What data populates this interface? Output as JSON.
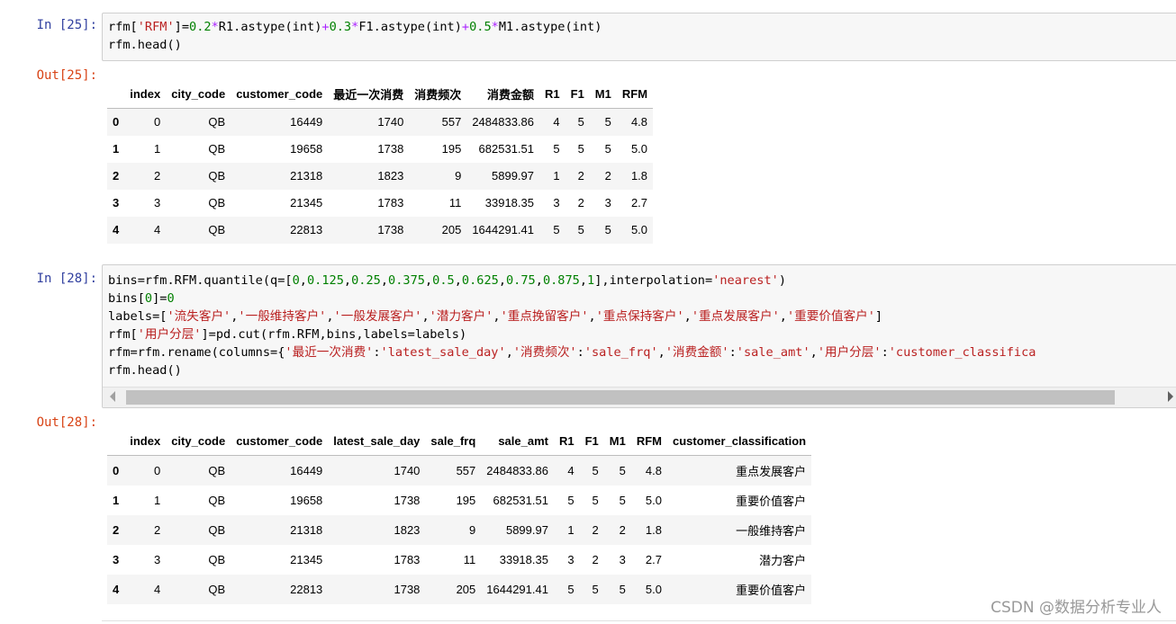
{
  "cells": [
    {
      "in_prompt": "In  [25]:",
      "out_prompt": "Out[25]:",
      "code_lines": [
        [
          [
            "t",
            "rfm["
          ],
          [
            "s",
            "'RFM'"
          ],
          [
            "t",
            "]="
          ],
          [
            "n",
            "0.2"
          ],
          [
            "o",
            "*"
          ],
          [
            "t",
            "R1.astype(int)"
          ],
          [
            "o",
            "+"
          ],
          [
            "n",
            "0.3"
          ],
          [
            "o",
            "*"
          ],
          [
            "t",
            "F1.astype(int)"
          ],
          [
            "o",
            "+"
          ],
          [
            "n",
            "0.5"
          ],
          [
            "o",
            "*"
          ],
          [
            "t",
            "M1.astype(int)"
          ]
        ],
        [
          [
            "t",
            "rfm.head()"
          ]
        ]
      ],
      "table": {
        "columns": [
          "",
          "index",
          "city_code",
          "customer_code",
          "最近一次消费",
          "消费频次",
          "消费金额",
          "R1",
          "F1",
          "M1",
          "RFM"
        ],
        "rows": [
          [
            "0",
            "0",
            "QB",
            "16449",
            "1740",
            "557",
            "2484833.86",
            "4",
            "5",
            "5",
            "4.8"
          ],
          [
            "1",
            "1",
            "QB",
            "19658",
            "1738",
            "195",
            "682531.51",
            "5",
            "5",
            "5",
            "5.0"
          ],
          [
            "2",
            "2",
            "QB",
            "21318",
            "1823",
            "9",
            "5899.97",
            "1",
            "2",
            "2",
            "1.8"
          ],
          [
            "3",
            "3",
            "QB",
            "21345",
            "1783",
            "11",
            "33918.35",
            "3",
            "2",
            "3",
            "2.7"
          ],
          [
            "4",
            "4",
            "QB",
            "22813",
            "1738",
            "205",
            "1644291.41",
            "5",
            "5",
            "5",
            "5.0"
          ]
        ]
      }
    },
    {
      "in_prompt": "In  [28]:",
      "out_prompt": "Out[28]:",
      "code_lines": [
        [
          [
            "t",
            "bins=rfm.RFM.quantile(q=["
          ],
          [
            "n",
            "0"
          ],
          [
            "t",
            ","
          ],
          [
            "n",
            "0.125"
          ],
          [
            "t",
            ","
          ],
          [
            "n",
            "0.25"
          ],
          [
            "t",
            ","
          ],
          [
            "n",
            "0.375"
          ],
          [
            "t",
            ","
          ],
          [
            "n",
            "0.5"
          ],
          [
            "t",
            ","
          ],
          [
            "n",
            "0.625"
          ],
          [
            "t",
            ","
          ],
          [
            "n",
            "0.75"
          ],
          [
            "t",
            ","
          ],
          [
            "n",
            "0.875"
          ],
          [
            "t",
            ","
          ],
          [
            "n",
            "1"
          ],
          [
            "t",
            "],interpolation="
          ],
          [
            "s",
            "'nearest'"
          ],
          [
            "t",
            ")"
          ]
        ],
        [
          [
            "t",
            "bins["
          ],
          [
            "n",
            "0"
          ],
          [
            "t",
            "]="
          ],
          [
            "n",
            "0"
          ]
        ],
        [
          [
            "t",
            "labels=["
          ],
          [
            "s",
            "'流失客户'"
          ],
          [
            "t",
            ","
          ],
          [
            "s",
            "'一般维持客户'"
          ],
          [
            "t",
            ","
          ],
          [
            "s",
            "'一般发展客户'"
          ],
          [
            "t",
            ","
          ],
          [
            "s",
            "'潜力客户'"
          ],
          [
            "t",
            ","
          ],
          [
            "s",
            "'重点挽留客户'"
          ],
          [
            "t",
            ","
          ],
          [
            "s",
            "'重点保持客户'"
          ],
          [
            "t",
            ","
          ],
          [
            "s",
            "'重点发展客户'"
          ],
          [
            "t",
            ","
          ],
          [
            "s",
            "'重要价值客户'"
          ],
          [
            "t",
            "]"
          ]
        ],
        [
          [
            "t",
            "rfm["
          ],
          [
            "s",
            "'用户分层'"
          ],
          [
            "t",
            "]=pd.cut(rfm.RFM,bins,labels=labels)"
          ]
        ],
        [
          [
            "t",
            "rfm=rfm.rename(columns={"
          ],
          [
            "s",
            "'最近一次消费'"
          ],
          [
            "t",
            ":"
          ],
          [
            "s",
            "'latest_sale_day'"
          ],
          [
            "t",
            ","
          ],
          [
            "s",
            "'消费频次'"
          ],
          [
            "t",
            ":"
          ],
          [
            "s",
            "'sale_frq'"
          ],
          [
            "t",
            ","
          ],
          [
            "s",
            "'消费金额'"
          ],
          [
            "t",
            ":"
          ],
          [
            "s",
            "'sale_amt'"
          ],
          [
            "t",
            ","
          ],
          [
            "s",
            "'用户分层'"
          ],
          [
            "t",
            ":"
          ],
          [
            "s",
            "'customer_classifica"
          ]
        ],
        [
          [
            "t",
            "rfm.head()"
          ]
        ]
      ],
      "table": {
        "columns": [
          "",
          "index",
          "city_code",
          "customer_code",
          "latest_sale_day",
          "sale_frq",
          "sale_amt",
          "R1",
          "F1",
          "M1",
          "RFM",
          "customer_classification"
        ],
        "rows": [
          [
            "0",
            "0",
            "QB",
            "16449",
            "1740",
            "557",
            "2484833.86",
            "4",
            "5",
            "5",
            "4.8",
            "重点发展客户"
          ],
          [
            "1",
            "1",
            "QB",
            "19658",
            "1738",
            "195",
            "682531.51",
            "5",
            "5",
            "5",
            "5.0",
            "重要价值客户"
          ],
          [
            "2",
            "2",
            "QB",
            "21318",
            "1823",
            "9",
            "5899.97",
            "1",
            "2",
            "2",
            "1.8",
            "一般维持客户"
          ],
          [
            "3",
            "3",
            "QB",
            "21345",
            "1783",
            "11",
            "33918.35",
            "3",
            "2",
            "3",
            "2.7",
            "潜力客户"
          ],
          [
            "4",
            "4",
            "QB",
            "22813",
            "1738",
            "205",
            "1644291.41",
            "5",
            "5",
            "5",
            "5.0",
            "重要价值客户"
          ]
        ]
      }
    }
  ],
  "watermark": "CSDN @数据分析专业人",
  "colors": {
    "string": "#ba2121",
    "number": "#008000",
    "operator": "#aa22ff",
    "in_prompt": "#303f9f",
    "out_prompt": "#d84315"
  }
}
